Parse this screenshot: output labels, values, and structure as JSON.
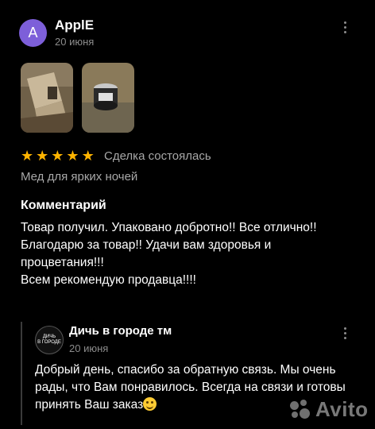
{
  "review": {
    "avatar_letter": "A",
    "author": "ApplE",
    "date": "20 июня",
    "rating": 5,
    "deal_status": "Сделка состоялась",
    "item_variant": "Мед для ярких ночей",
    "comment_heading": "Комментарий",
    "comment_text": "Товар получил. Упаковано добротно!!  Все отлично!!\nБлагодарю за товар!! Удачи вам здоровья и процветания!!!\nВсем рекомендую продавца!!!!",
    "photos": [
      "box-photo",
      "jar-photo"
    ]
  },
  "reply": {
    "seller_name": "Дичь в городе тм",
    "seller_logo_text": "ДИЧЬ В ГОРОДЕ",
    "date": "20 июня",
    "text": "Добрый день, спасибо за обратную связь. Мы очень рады, что Вам понравилось. Всегда на связи и готовы принять Ваш заказ"
  },
  "watermark": {
    "text": "Avito"
  },
  "colors": {
    "star": "#ffb400",
    "avatar": "#7d5fd9",
    "muted": "#8c8c8c"
  }
}
